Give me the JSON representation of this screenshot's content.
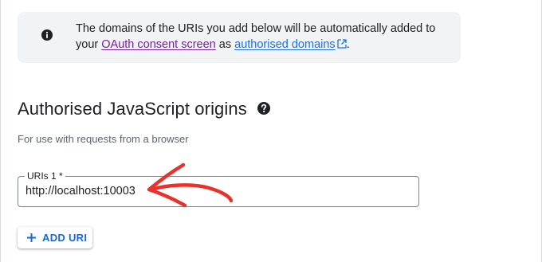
{
  "info": {
    "text_before": "The domains of the URIs you add below will be automatically added to your",
    "link_consent": "OAuth consent screen",
    "text_middle": "as",
    "link_domains": "authorised domains",
    "text_after": ".",
    "icon": "info-icon"
  },
  "section": {
    "title": "Authorised JavaScript origins",
    "help_icon": "help-icon",
    "subtitle": "For use with requests from a browser"
  },
  "uri_field": {
    "label": "URIs 1 *",
    "value": "http://localhost:10003"
  },
  "add_button": {
    "label": "ADD URI",
    "icon": "plus-icon"
  },
  "colors": {
    "accent": "#1a73e8",
    "visited_link": "#7b1fa2",
    "annotation_arrow": "#e8322b",
    "info_bg": "#f1f3f4"
  }
}
